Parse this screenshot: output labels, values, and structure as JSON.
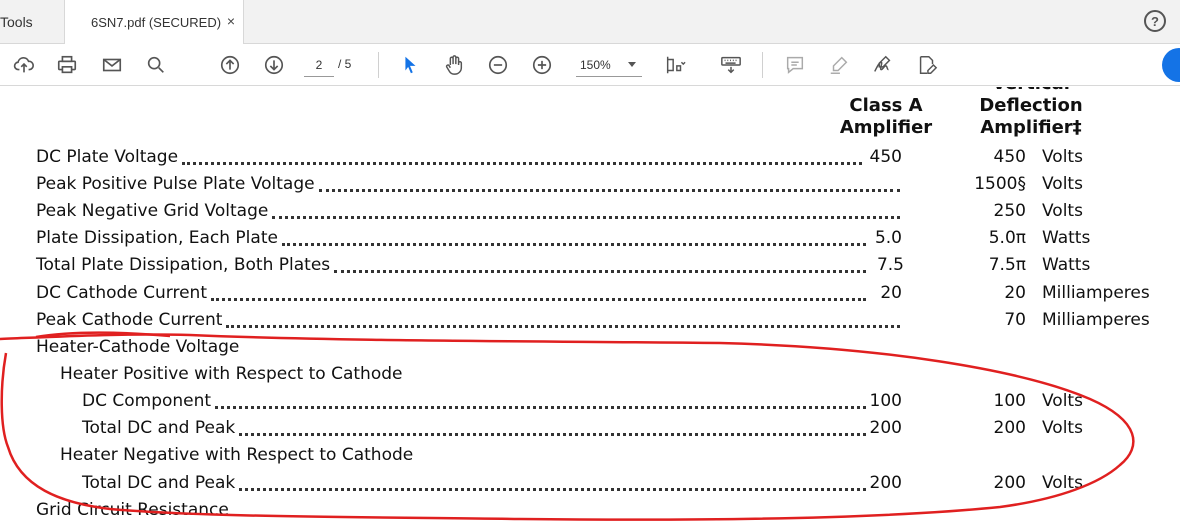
{
  "tabs": {
    "tools_label": "Tools",
    "doc_label": "6SN7.pdf (SECURED)",
    "close_glyph": "×",
    "help_glyph": "?"
  },
  "toolbar": {
    "page_current": "2",
    "page_total": "/ 5",
    "zoom": "150%",
    "icons": [
      "upload-cloud-icon",
      "print-icon",
      "email-icon",
      "search-icon",
      "page-up-icon",
      "page-down-icon",
      "select-arrow-icon",
      "hand-icon",
      "zoom-out-icon",
      "zoom-in-icon",
      "fit-page-icon",
      "keyboard-icon",
      "comment-icon",
      "highlight-icon",
      "sign-icon",
      "fill-sign-icon"
    ]
  },
  "document": {
    "headers": {
      "class_a": [
        "Class A",
        "Amplifier"
      ],
      "vertical": [
        "Vertical",
        "Deflection",
        "Amplifier‡"
      ]
    },
    "rows": [
      {
        "label": "DC Plate Voltage",
        "v1": "450",
        "v2": "450",
        "unit": "Volts"
      },
      {
        "label": "Peak Positive Pulse Plate Voltage",
        "v1": "",
        "v2": "1500§",
        "unit": "Volts"
      },
      {
        "label": "Peak Negative Grid Voltage",
        "v1": "",
        "v2": "250",
        "unit": "Volts"
      },
      {
        "label": "Plate Dissipation, Each Plate",
        "v1": "5.0",
        "v2": "5.0π",
        "unit": "Watts"
      },
      {
        "label": "Total Plate Dissipation, Both Plates",
        "v1": "7.5",
        "v2": "7.5π",
        "unit": "Watts"
      },
      {
        "label": "DC Cathode Current",
        "v1": "20",
        "v2": "20",
        "unit": "Milliamperes"
      },
      {
        "label": "Peak Cathode Current",
        "v1": "",
        "v2": "70",
        "unit": "Milliamperes"
      },
      {
        "label": "Heater-Cathode Voltage",
        "v1": "",
        "v2": "",
        "unit": ""
      },
      {
        "label": "Heater Positive with Respect to Cathode",
        "v1": "",
        "v2": "",
        "unit": ""
      },
      {
        "label": "DC Component",
        "v1": "100",
        "v2": "100",
        "unit": "Volts"
      },
      {
        "label": "Total DC and Peak",
        "v1": "200",
        "v2": "200",
        "unit": "Volts"
      },
      {
        "label": "Heater Negative with Respect to Cathode",
        "v1": "",
        "v2": "",
        "unit": ""
      },
      {
        "label": "Total DC and Peak",
        "v1": "200",
        "v2": "200",
        "unit": "Volts"
      },
      {
        "label": "Grid Circuit Resistance",
        "v1": "",
        "v2": "",
        "unit": ""
      }
    ],
    "annotation_color": "#e02020"
  }
}
